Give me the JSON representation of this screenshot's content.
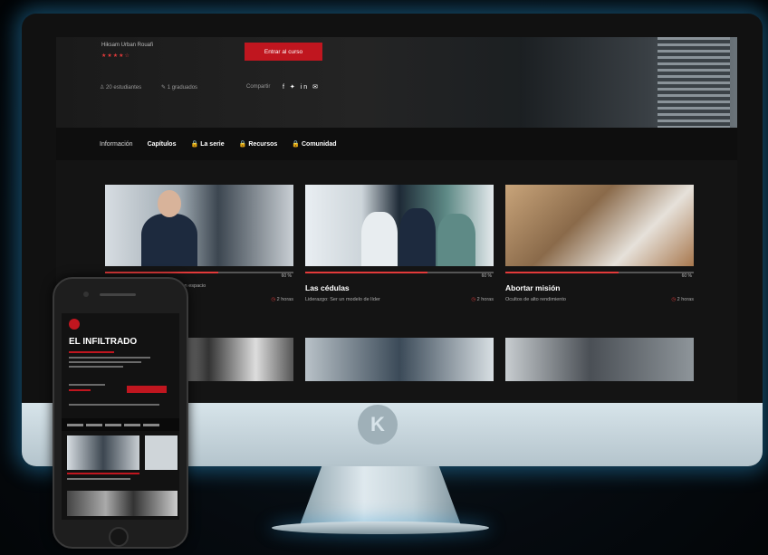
{
  "hero": {
    "author": "Hiksam  Urban Rouafi",
    "stars": "★★★★☆",
    "students": "♙  20 estudiantes",
    "graduates": "✎  1 graduados",
    "share_label": "Compartir",
    "social": "f ✦ in ✉",
    "cta_label": "Entrar al curso"
  },
  "tabs": [
    {
      "label": "Información"
    },
    {
      "label": "Capítulos"
    },
    {
      "label": "La serie"
    },
    {
      "label": "Recursos"
    },
    {
      "label": "Comunidad"
    }
  ],
  "cards": [
    {
      "title": "",
      "percent": "60 %",
      "desc": "n un espacio",
      "hours": "2 horas",
      "progress": 0.6
    },
    {
      "title": "Las cédulas",
      "percent": "60 %",
      "desc": "Liderazgo: Ser un modelo de líder",
      "hours": "2 horas",
      "progress": 0.65
    },
    {
      "title": "Abortar misión",
      "percent": "60 %",
      "desc": "Ocultos de alto rendimiento",
      "hours": "2 horas",
      "progress": 0.6
    }
  ],
  "phone": {
    "title": "EL INFILTRADO"
  },
  "brand_logo": "K",
  "colors": {
    "accent": "#c0161f",
    "glow": "#2896d2"
  }
}
